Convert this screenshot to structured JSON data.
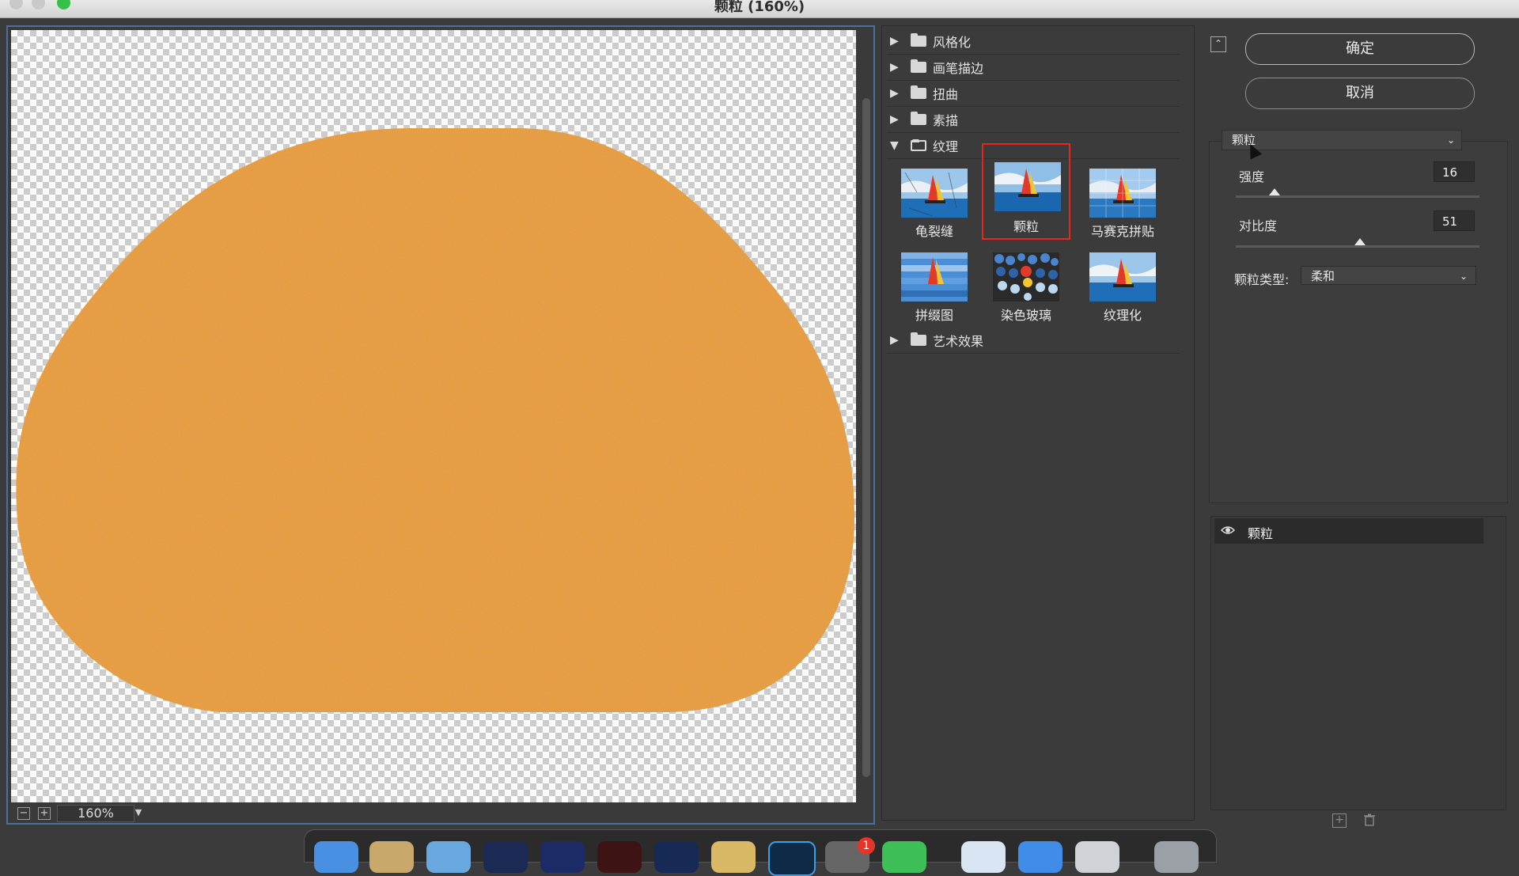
{
  "window": {
    "title": "颗粒 (160%)"
  },
  "preview": {
    "zoom": "160%",
    "shape_color": "#e89c34"
  },
  "filter_gallery": {
    "categories": [
      {
        "label": "风格化",
        "expanded": false
      },
      {
        "label": "画笔描边",
        "expanded": false
      },
      {
        "label": "扭曲",
        "expanded": false
      },
      {
        "label": "素描",
        "expanded": false
      },
      {
        "label": "纹理",
        "expanded": true
      },
      {
        "label": "艺术效果",
        "expanded": false
      }
    ],
    "texture_filters": [
      {
        "label": "龟裂缝",
        "selected": false
      },
      {
        "label": "颗粒",
        "selected": true
      },
      {
        "label": "马赛克拼贴",
        "selected": false
      },
      {
        "label": "拼缀图",
        "selected": false
      },
      {
        "label": "染色玻璃",
        "selected": false
      },
      {
        "label": "纹理化",
        "selected": false
      }
    ]
  },
  "settings": {
    "ok_label": "确定",
    "cancel_label": "取消",
    "filter_select": "颗粒",
    "params": [
      {
        "label": "强度",
        "value": "16",
        "fraction": 0.16
      },
      {
        "label": "对比度",
        "value": "51",
        "fraction": 0.51
      }
    ],
    "grain_type_label": "颗粒类型:",
    "grain_type_value": "柔和"
  },
  "layers": {
    "items": [
      {
        "name": "颗粒",
        "visible": true
      }
    ]
  },
  "dock": {
    "badge": "1"
  },
  "colors": {
    "selection": "#e8261c",
    "accent": "#4e6f9c"
  }
}
